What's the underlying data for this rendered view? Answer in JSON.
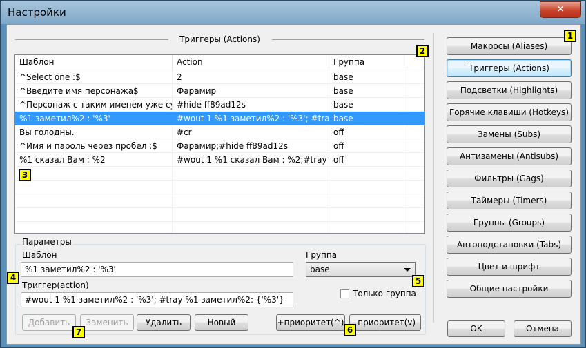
{
  "window": {
    "title": "Настройки",
    "close_glyph": "✕"
  },
  "triggers_group": {
    "title": "Триггеры (Actions)"
  },
  "table": {
    "headers": [
      "Шаблон",
      "Action",
      "Группа"
    ],
    "rows": [
      [
        "^Select one :$",
        "2",
        "base"
      ],
      [
        "^Введите имя персонажа$",
        "Фарамир",
        "base"
      ],
      [
        "^Персонаж с таким именем уже сущ",
        "#hide ff89ad12s",
        "base"
      ],
      [
        "%1 заметил%2 : '%3'",
        "#wout  1  %1 заметил%2 : '%3'; #tray",
        "base"
      ],
      [
        "Вы голодны.",
        "#cr",
        "off"
      ],
      [
        "^Имя и пароль через пробел :$",
        "Фарамир;#hide ff89ad12s",
        "off"
      ],
      [
        "%1 сказал Вам : %2",
        "#wout 1 %1 сказал Вам : %2;#tray %",
        "off"
      ]
    ],
    "selected_row": 3
  },
  "params": {
    "title": "Параметры",
    "pattern_label": "Шаблон",
    "pattern_value": "%1 заметил%2 : '%3'",
    "trigger_label": "Триггер(action)",
    "trigger_value": "#wout  1  %1 заметил%2 : '%3'; #tray %1 заметил%2: {'%3'}",
    "group_label": "Группа",
    "group_value": "base",
    "only_group_label": "Только группа"
  },
  "buttons": {
    "add": "Добавить",
    "replace": "Заменить",
    "delete": "Удалить",
    "new": "Новый",
    "priority_up": "+приоритет(^)",
    "priority_down": "-приоритет(v)",
    "ok": "OK",
    "cancel": "Отмена"
  },
  "side_menu": [
    "Макросы (Aliases)",
    "Триггеры (Actions)",
    "Подсветки (Highlights)",
    "Горячие клавиши (Hotkeys)",
    "Замены (Subs)",
    "Антизамены (Antisubs)",
    "Фильтры (Gags)",
    "Таймеры (Timers)",
    "Группы (Groups)",
    "Автоподстановки (Tabs)",
    "Цвет и шрифт",
    "Общие настройки"
  ],
  "active_side_item": 1,
  "badges": [
    "1",
    "2",
    "3",
    "4",
    "5",
    "6",
    "7"
  ],
  "colors": {
    "selection": "#3399ff",
    "badge": "#ffff00",
    "titlebar": "#7fa7c8"
  }
}
